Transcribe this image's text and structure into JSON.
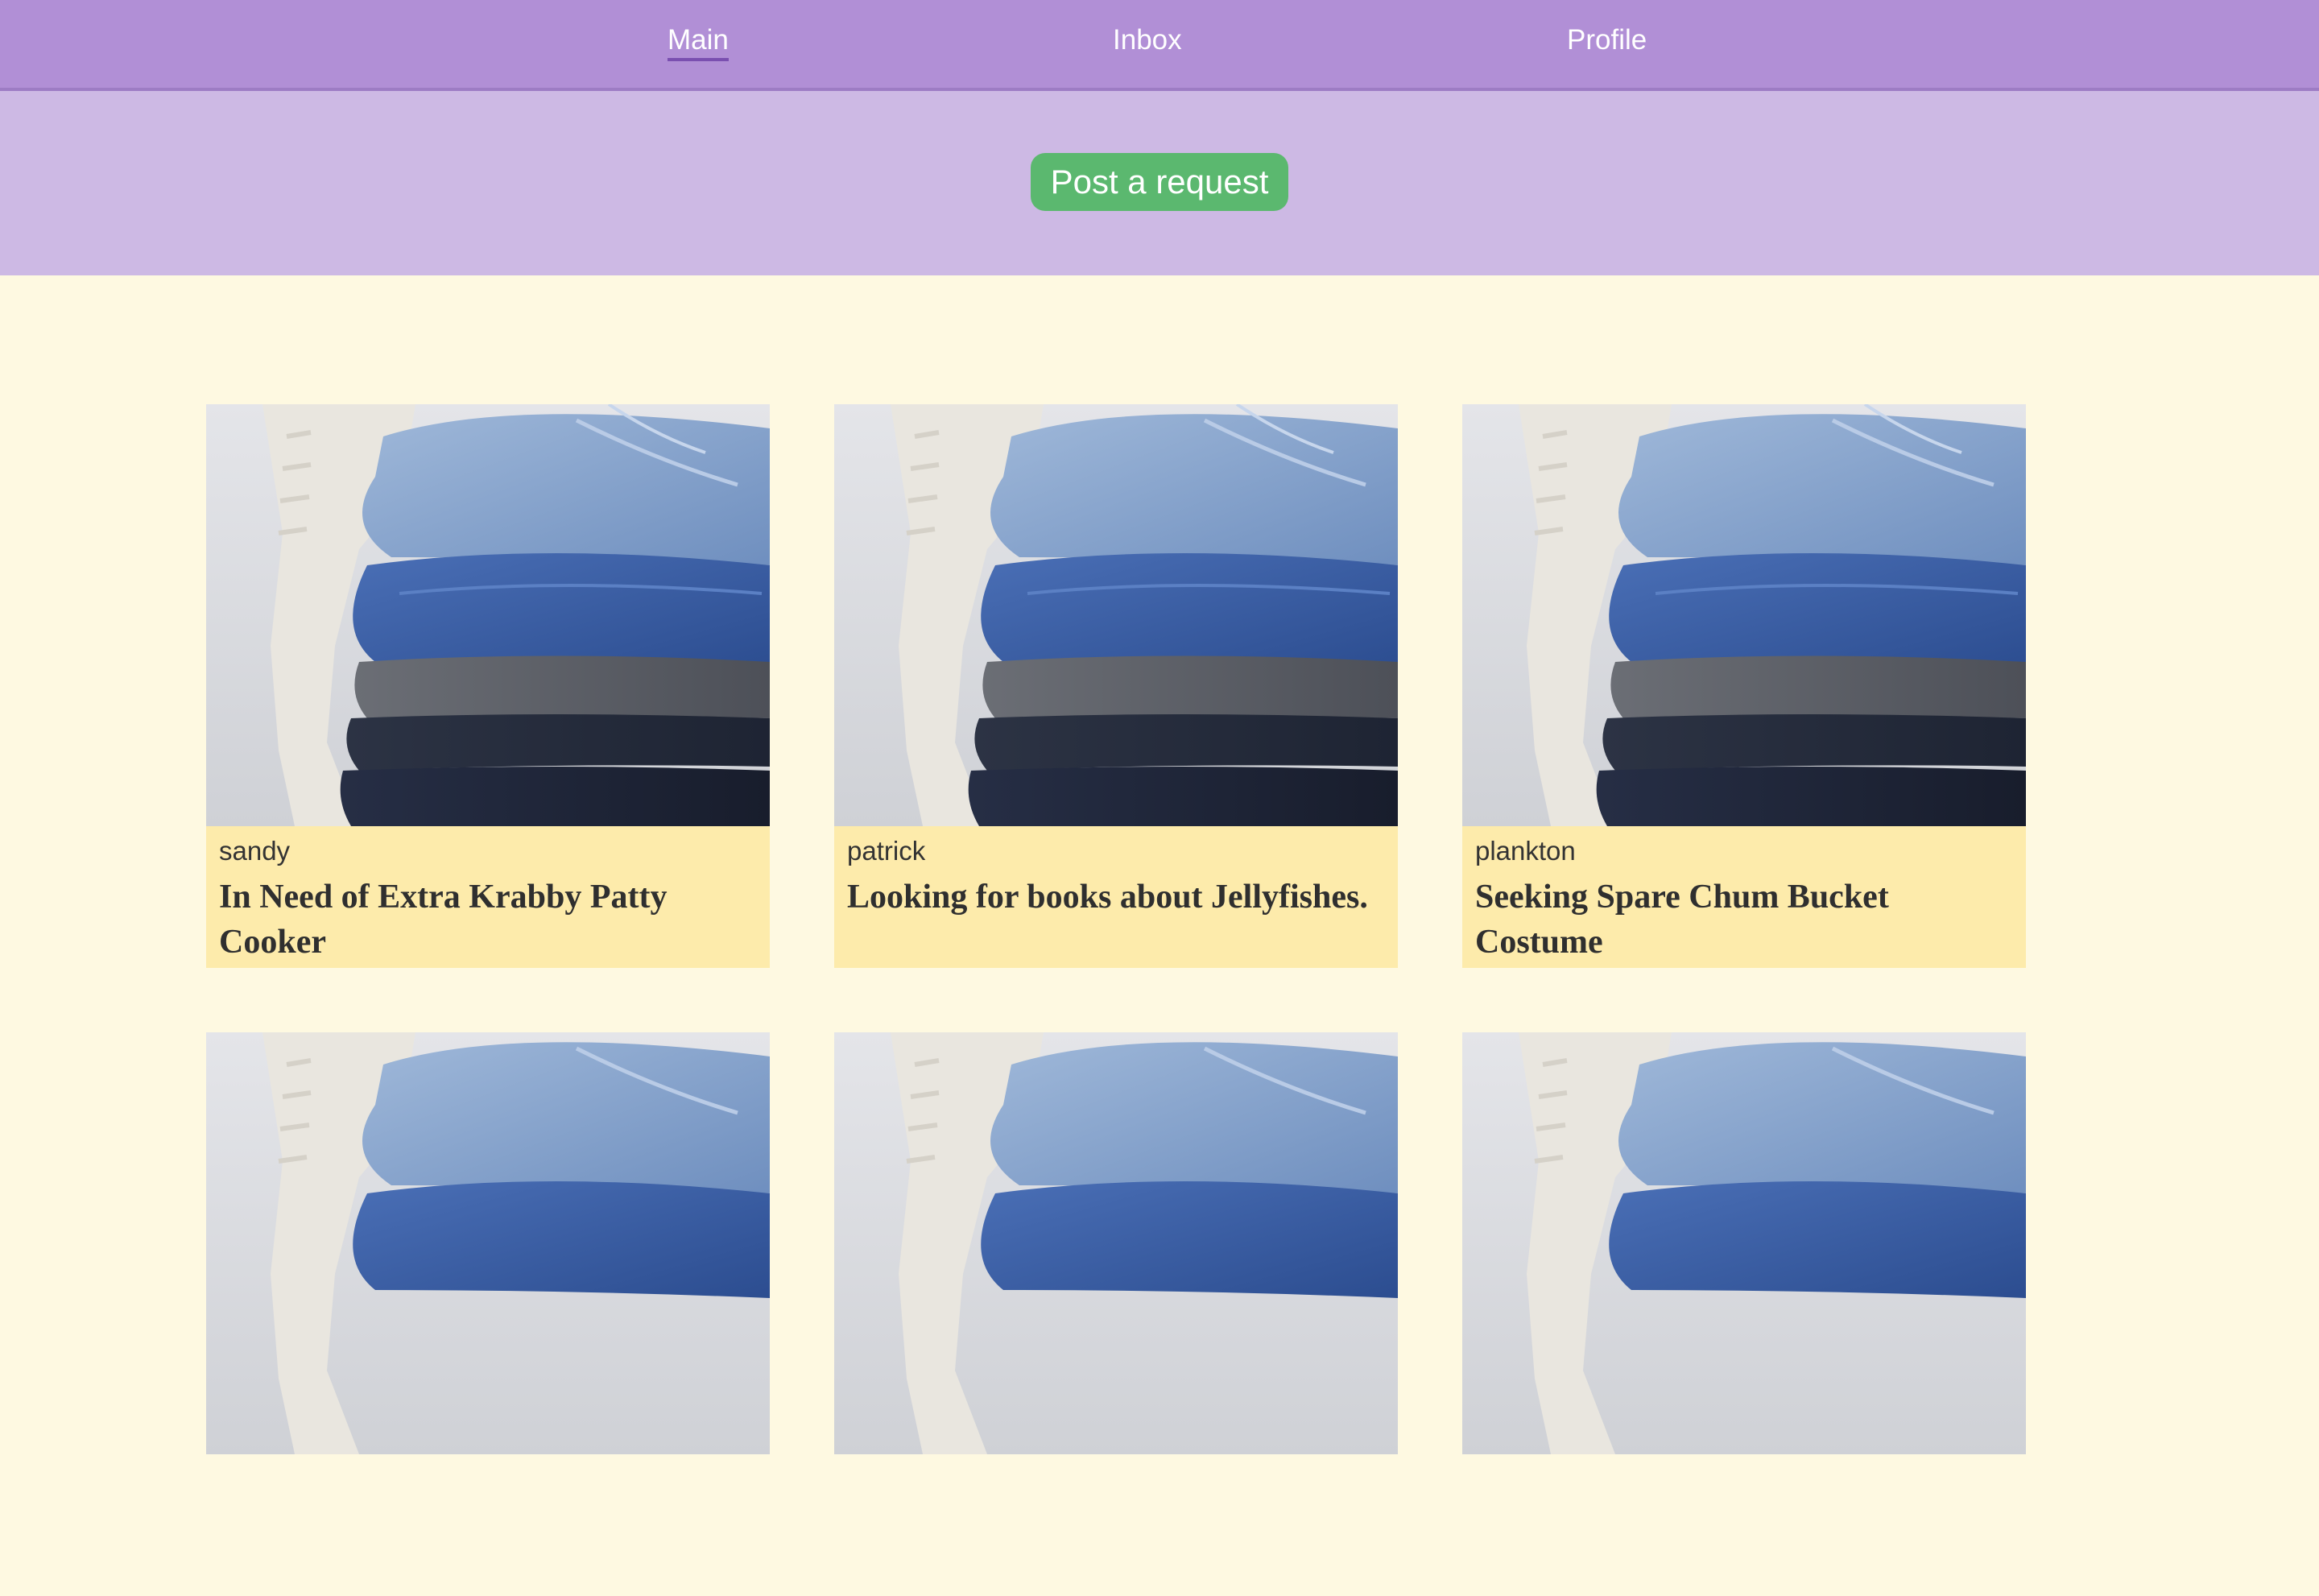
{
  "nav": {
    "items": [
      {
        "label": "Main",
        "active": true
      },
      {
        "label": "Inbox",
        "active": false
      },
      {
        "label": "Profile",
        "active": false
      }
    ]
  },
  "actions": {
    "post_request_label": "Post a request",
    "post_request_color": "#5bb86f"
  },
  "colors": {
    "nav_bg": "#b18fd6",
    "band_bg": "#cdb9e4",
    "page_bg": "#fef9e1",
    "caption_bg": "#fdebab"
  },
  "cards": [
    {
      "user": "sandy",
      "title": "In Need of Extra Krabby Patty Cooker",
      "image": "folded-jeans-stack-photo"
    },
    {
      "user": "patrick",
      "title": "Looking for books about Jellyfishes.",
      "image": "folded-jeans-stack-photo"
    },
    {
      "user": "plankton",
      "title": "Seeking Spare Chum Bucket Costume",
      "image": "folded-jeans-stack-photo"
    },
    {
      "user": "",
      "title": "",
      "image": "folded-jeans-stack-photo"
    },
    {
      "user": "",
      "title": "",
      "image": "folded-jeans-stack-photo"
    },
    {
      "user": "",
      "title": "",
      "image": "folded-jeans-stack-photo"
    }
  ]
}
